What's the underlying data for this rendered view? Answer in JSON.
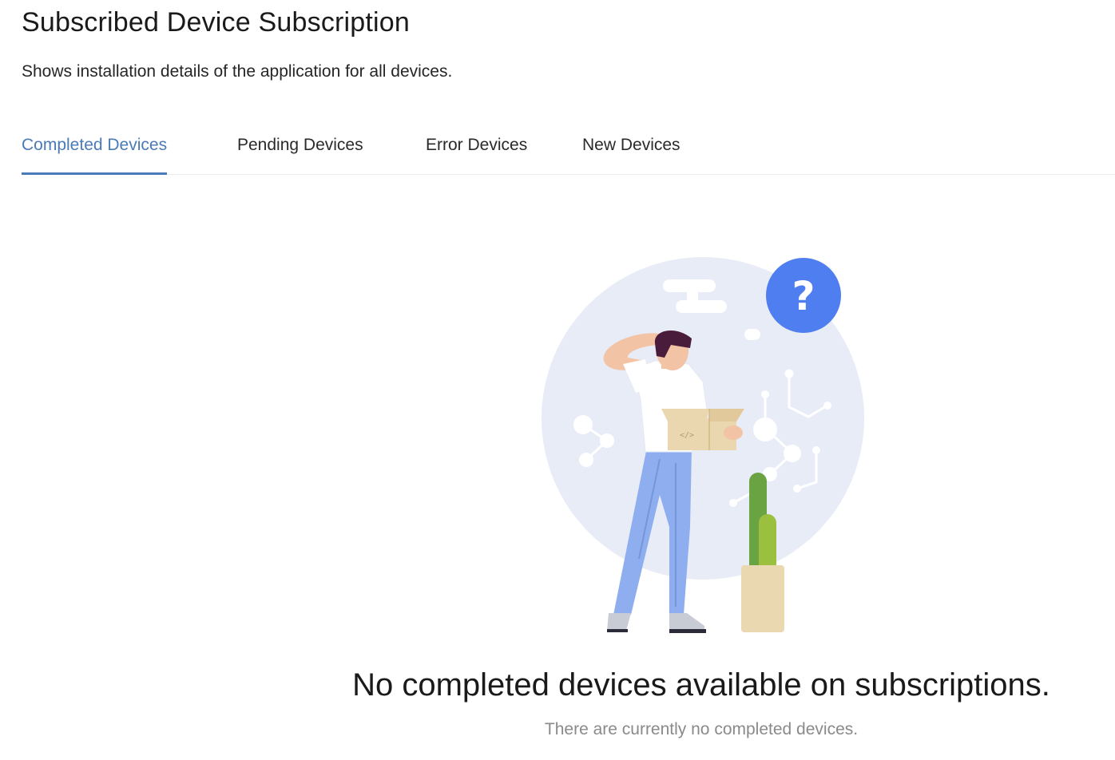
{
  "header": {
    "title": "Subscribed Device Subscription",
    "subtitle": "Shows installation details of the application for all devices."
  },
  "tabs": [
    {
      "label": "Completed Devices",
      "active": true
    },
    {
      "label": "Pending Devices",
      "active": false
    },
    {
      "label": "Error Devices",
      "active": false
    },
    {
      "label": "New Devices",
      "active": false
    }
  ],
  "empty_state": {
    "title": "No completed devices available on subscriptions.",
    "message": "There are currently no completed devices.",
    "badge_glyph": "?"
  },
  "colors": {
    "accent": "#4a7ab7",
    "question_badge": "#4f7ef1",
    "illustration_bg": "#e8ecf7"
  }
}
